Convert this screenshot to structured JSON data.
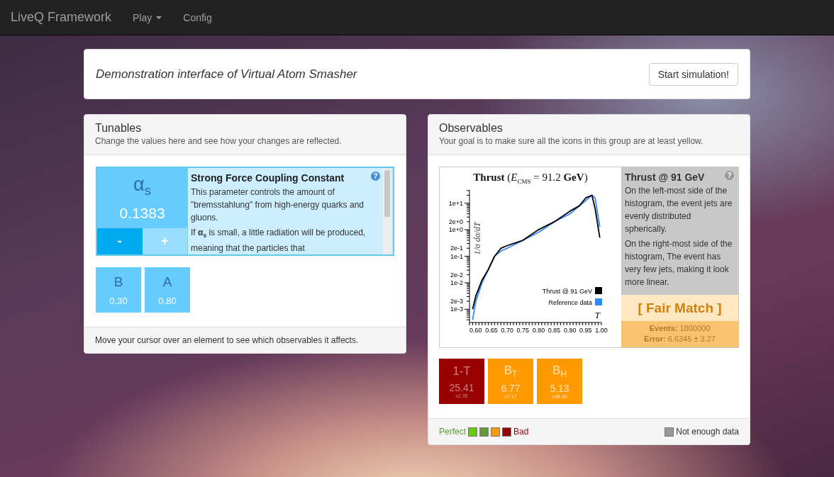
{
  "navbar": {
    "brand": "LiveQ Framework",
    "items": [
      {
        "label": "Play",
        "kind": "dropdown"
      },
      {
        "label": "Config",
        "kind": "link"
      }
    ]
  },
  "intro": {
    "title": "Demonstration interface of Virtual Atom Smasher",
    "button": "Start simulation!"
  },
  "tunables": {
    "title": "Tunables",
    "subtitle": "Change the values here and see how your changes are reflected.",
    "featured": {
      "symbol": "α$_{s}$",
      "value": "0.1383",
      "decrease": "-",
      "increase": "+",
      "info": {
        "title": "Strong Force Coupling Constant",
        "help": "?",
        "paragraphs": [
          "This parameter controls the amount of \"bremsstahlung\" from high-energy quarks and gluons.",
          "If **α$_{s}$** is small, a little radiation will be produced, meaning that the particles that"
        ]
      }
    },
    "items": [
      {
        "symbol": "B",
        "value": "0.30"
      },
      {
        "symbol": "A",
        "value": "0.80"
      }
    ],
    "footer": "Move your cursor over an element to see which observables it affects."
  },
  "observables": {
    "title": "Observables",
    "subtitle": "Your goal is to make sure all the icons in this group are at least yellow.",
    "featured": {
      "plot": {
        "title": "**Thrust**  (*E*$_{CMS}$ = 91.2  **GeV**)",
        "xlabel": "T",
        "ylabel": "1/σ  dσ/dT",
        "xtick_labels": [
          "0.60",
          "0.65",
          "0.70",
          "0.75",
          "0.80",
          "0.85",
          "0.90",
          "0.95",
          "1.00"
        ],
        "ytick_labels": [
          "1e+1",
          "2e+0",
          "1e+0",
          "2e-1",
          "1e-1",
          "2e-2",
          "1e-2",
          "2e-3",
          "1e-3"
        ],
        "legend": [
          {
            "label": "Thrust @ 91 GeV",
            "color": "#000000"
          },
          {
            "label": "Reference data",
            "color": "#3388ff"
          }
        ]
      },
      "info": {
        "title": "Thrust @ 91 GeV",
        "help": "?",
        "paragraphs": [
          "On the left-most side of the histogram, the event jets are evenly distributed spherically.",
          "On the right-most side of the histogram, The event has very few jets, making it look more linear."
        ]
      },
      "match": "[ Fair Match ]",
      "events": "**Events:** 1800000",
      "error": "**Error:** 6.6345 ± 3.27"
    },
    "items": [
      {
        "symbol": "1-T",
        "value": "25.41",
        "error": "±2.95",
        "color": "#990000"
      },
      {
        "symbol": "B$_{T}$",
        "value": "6.77",
        "error": "±7.17",
        "color": "#ff9900"
      },
      {
        "symbol": "B$_{H}$",
        "value": "5.13",
        "error": "±98.00",
        "color": "#ff9900"
      }
    ],
    "legend": {
      "best": "Perfect",
      "worst": "Bad",
      "swatches": [
        {
          "color": "#66cc00"
        },
        {
          "color": "#669933"
        },
        {
          "color": "#ff9900"
        },
        {
          "color": "#990000"
        }
      ],
      "missing": {
        "label": "Not enough data",
        "color": "#999999"
      }
    }
  }
}
